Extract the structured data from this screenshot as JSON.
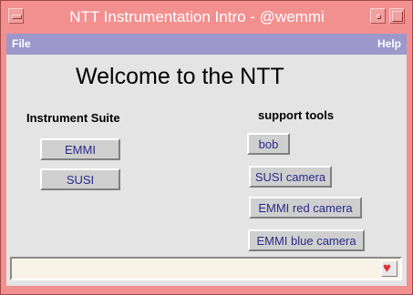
{
  "window": {
    "title": "NTT Instrumentation Intro  -  @wemmi"
  },
  "menubar": {
    "file": "File",
    "help": "Help"
  },
  "main": {
    "heading": "Welcome to the NTT",
    "instrument_suite": {
      "label": "Instrument Suite",
      "buttons": [
        "EMMI",
        "SUSI"
      ]
    },
    "support_tools": {
      "label": "support tools",
      "buttons": [
        "bob",
        "SUSI camera",
        "EMMI red camera",
        "EMMI blue camera"
      ]
    }
  },
  "status": {
    "text": "",
    "icon": "heart-icon"
  },
  "colors": {
    "frame": "#f29090",
    "menubar": "#9c98cc",
    "background": "#e4e4e4",
    "button_text": "#2a2a8a",
    "status_bg": "#f7f3e6",
    "heart": "#e23030"
  }
}
